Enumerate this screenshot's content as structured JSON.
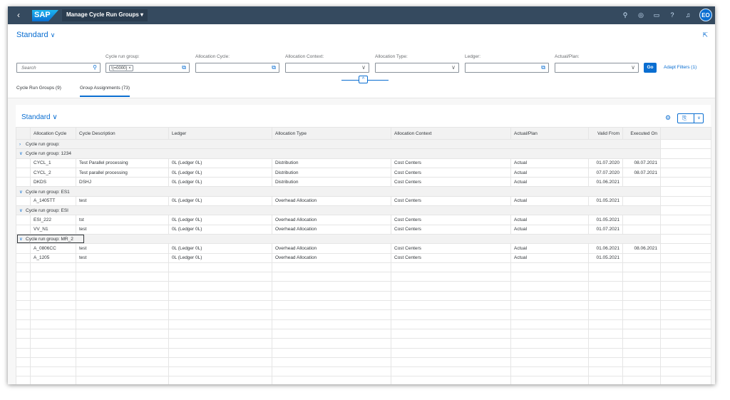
{
  "shell": {
    "app_title": "Manage Cycle Run Groups",
    "logo_text": "SAP",
    "avatar": "EO",
    "icons": [
      "search-icon",
      "notes-icon",
      "feedback-icon",
      "help-icon",
      "bell-icon"
    ]
  },
  "header": {
    "variant": "Standard"
  },
  "filters": {
    "search_placeholder": "Search",
    "cycle_run_group_label": "Cycle run group:",
    "cycle_run_group_token": "!(=0000)",
    "allocation_cycle_label": "Allocation Cycle:",
    "allocation_context_label": "Allocation Context:",
    "allocation_type_label": "Allocation Type:",
    "ledger_label": "Ledger:",
    "actual_plan_label": "Actual/Plan:",
    "go_label": "Go",
    "adapt_label": "Adapt Filters (1)"
  },
  "tabs": [
    {
      "label": "Cycle Run Groups (9)"
    },
    {
      "label": "Group Assignments (73)"
    }
  ],
  "table": {
    "variant": "Standard",
    "headers": [
      "Allocation Cycle",
      "Cycle Description",
      "Ledger",
      "Allocation Type",
      "Allocation Context",
      "Actual/Plan",
      "Valid From",
      "Executed On"
    ],
    "groups": [
      {
        "label": "Cycle run group:",
        "expanded": false,
        "rows": []
      },
      {
        "label": "Cycle run group: 1234",
        "expanded": true,
        "rows": [
          {
            "cycle": "CYCL_1",
            "desc": "Test Parallel processing",
            "ledger": "0L (Ledger 0L)",
            "type": "Distribution",
            "context": "Cost Centers",
            "ap": "Actual",
            "valid": "01.07.2020",
            "exec": "08.07.2021"
          },
          {
            "cycle": "CYCL_2",
            "desc": "Test parallel processing",
            "ledger": "0L (Ledger 0L)",
            "type": "Distribution",
            "context": "Cost Centers",
            "ap": "Actual",
            "valid": "07.07.2020",
            "exec": "08.07.2021"
          },
          {
            "cycle": "DKDS",
            "desc": "DSHJ",
            "ledger": "0L (Ledger 0L)",
            "type": "Distribution",
            "context": "Cost Centers",
            "ap": "Actual",
            "valid": "01.06.2021",
            "exec": ""
          }
        ]
      },
      {
        "label": "Cycle run group: ES1",
        "expanded": true,
        "rows": [
          {
            "cycle": "A_1405TT",
            "desc": "test",
            "ledger": "0L (Ledger 0L)",
            "type": "Overhead Allocation",
            "context": "Cost Centers",
            "ap": "Actual",
            "valid": "01.05.2021",
            "exec": ""
          }
        ]
      },
      {
        "label": "Cycle run group: ESI",
        "expanded": true,
        "rows": [
          {
            "cycle": "ESI_222",
            "desc": "tst",
            "ledger": "0L (Ledger 0L)",
            "type": "Overhead Allocation",
            "context": "Cost Centers",
            "ap": "Actual",
            "valid": "01.05.2021",
            "exec": ""
          },
          {
            "cycle": "VV_N1",
            "desc": "test",
            "ledger": "0L (Ledger 0L)",
            "type": "Overhead Allocation",
            "context": "Cost Centers",
            "ap": "Actual",
            "valid": "01.07.2021",
            "exec": ""
          }
        ]
      },
      {
        "label": "Cycle run group: MR_2",
        "expanded": true,
        "rows": [
          {
            "cycle": "A_0806CC",
            "desc": "test",
            "ledger": "0L (Ledger 0L)",
            "type": "Overhead Allocation",
            "context": "Cost Centers",
            "ap": "Actual",
            "valid": "01.06.2021",
            "exec": "08.06.2021"
          },
          {
            "cycle": "A_1205",
            "desc": "test",
            "ledger": "0L (Ledger 0L)",
            "type": "Overhead Allocation",
            "context": "Cost Centers",
            "ap": "Actual",
            "valid": "01.05.2021",
            "exec": ""
          }
        ]
      }
    ]
  }
}
